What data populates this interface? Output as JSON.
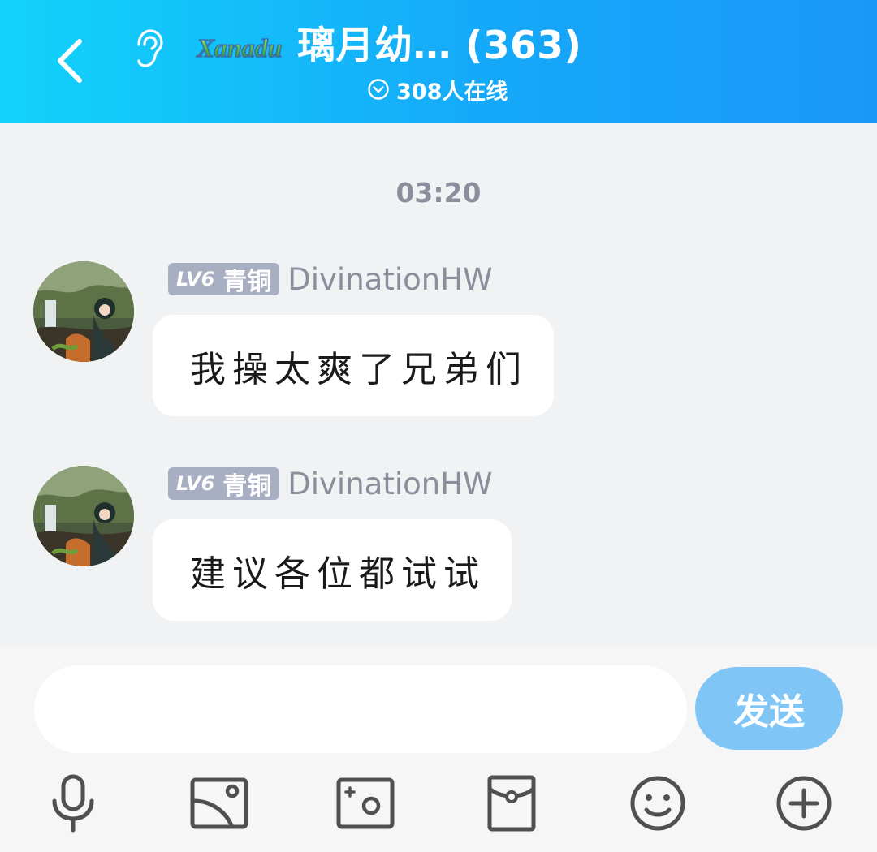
{
  "header": {
    "logo_text": "Xanadu",
    "title": "璃月幼… (363)",
    "online_text": "308人在线",
    "gradient_start": "#12d3fa",
    "gradient_end": "#1a98fa"
  },
  "chat": {
    "timestamp": "03:20",
    "messages": [
      {
        "level": "LV6",
        "level_title": "青铜",
        "sender": "DivinationHW",
        "text": "我操太爽了兄弟们"
      },
      {
        "level": "LV6",
        "level_title": "青铜",
        "sender": "DivinationHW",
        "text": "建议各位都试试"
      }
    ]
  },
  "input": {
    "placeholder": "",
    "send_label": "发送",
    "send_color": "#7fc6f6"
  },
  "toolbar": {
    "icons": [
      "microphone-icon",
      "image-icon",
      "camera-icon",
      "red-packet-icon",
      "emoji-icon",
      "plus-icon"
    ]
  },
  "colors": {
    "background": "#f1f2f3",
    "badge": "#a9afc3",
    "meta_text": "#8b8f9d"
  }
}
